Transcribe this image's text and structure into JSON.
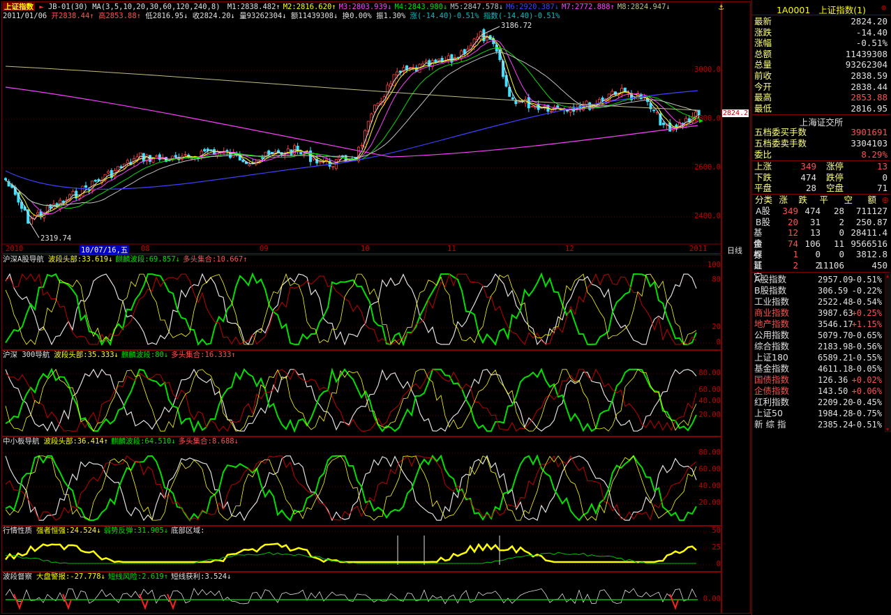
{
  "top": {
    "title": "上证指数",
    "formula": "JB-01(30)",
    "ma_label": "MA(3,5,10,20,30,60,120,240,8)",
    "ma_values": [
      {
        "text": "M1:2838.482↑",
        "color": "#e0e0e0"
      },
      {
        "text": "M2:2816.620↑",
        "color": "#ffff00"
      },
      {
        "text": "M3:2803.939↓",
        "color": "#ff40ff"
      },
      {
        "text": "M4:2843.980↓",
        "color": "#00e000"
      },
      {
        "text": "M5:2847.578↓",
        "color": "#c0c0c0"
      },
      {
        "text": "M6:2920.387↓",
        "color": "#4040ff"
      },
      {
        "text": "M7:2772.888↑",
        "color": "#ff40ff"
      },
      {
        "text": "M8:2824.947↓",
        "color": "#c0c080"
      }
    ],
    "info": {
      "date": "2011/01/06",
      "open": "开2838.44↑",
      "high": "高2853.88↑",
      "low": "低2816.95↓",
      "close": "收2824.20↓",
      "volume": "量93262304↓",
      "amount": "额11439308↓",
      "turnover": "换0.00%",
      "amplitude": "振1.30%",
      "change": "涨(-14.40)-0.51%",
      "index_change": "指数(-14.40)-0.51%"
    },
    "peak_label": "3186.72",
    "low_label": "2319.74",
    "current_price_tag": "2824.2",
    "y_ticks": [
      "3000.0",
      "2800.0",
      "2600.0",
      "2400.0"
    ],
    "x_ticks": [
      "2010",
      "08",
      "09",
      "10",
      "11",
      "12",
      "2011"
    ],
    "date_cursor": "10/07/16,五",
    "period": "日线"
  },
  "panels": [
    {
      "title": "沪深A股导航",
      "a": "波段头部:33.619↓",
      "b": "麒麟波段:69.857↓",
      "c": "多头集合:10.667↑",
      "ticks": [
        "100",
        "80",
        "20",
        "0"
      ]
    },
    {
      "title": "沪深 300导航",
      "a": "波段头部:35.333↓",
      "b": "麒麟波段:80↓",
      "c": "多头集合:16.333↑",
      "ticks": [
        "80.00",
        "60.00",
        "40.00",
        "20.00"
      ]
    },
    {
      "title": "中小板导航",
      "a": "波段头部:36.414↑",
      "b": "麒麟波段:64.510↓",
      "c": "多头集合:8.688↓",
      "ticks": [
        "80.00",
        "60.00",
        "40.00",
        "20.00"
      ]
    },
    {
      "title": "行情性质",
      "a": "强者恒强:24.524↓",
      "b": "弱势反弹:31.905↓",
      "c": "底部区域:",
      "ticks": [
        "50",
        "25",
        "0"
      ]
    },
    {
      "title": "波段督察",
      "a": "大盘警报:-27.778↓",
      "b": "短线风险:2.619↑",
      "c": "短线获利:3.524↓",
      "ticks": [
        "0.00"
      ]
    }
  ],
  "right": {
    "code": "1A0001",
    "name": "上证指数(1)",
    "quotes": [
      {
        "label": "最新",
        "value": "2824.20",
        "color": "#e0e0e0"
      },
      {
        "label": "涨跌",
        "value": "-14.40",
        "color": "#e0e0e0"
      },
      {
        "label": "涨幅",
        "value": "-0.51%",
        "color": "#e0e0e0"
      },
      {
        "label": "总额",
        "value": "11439308",
        "color": "#e0e0e0"
      },
      {
        "label": "总量",
        "value": "93262304",
        "color": "#e0e0e0"
      },
      {
        "label": "前收",
        "value": "2838.59",
        "color": "#e0e0e0"
      },
      {
        "label": "今开",
        "value": "2838.44",
        "color": "#e0e0e0"
      },
      {
        "label": "最高",
        "value": "2853.88",
        "color": "#ff5050"
      },
      {
        "label": "最低",
        "value": "2816.95",
        "color": "#e0e0e0"
      }
    ],
    "exchange": "上海证交所",
    "orders": [
      {
        "label": "五档委买手数",
        "value": "3901691",
        "color": "#ff5050"
      },
      {
        "label": "五档委卖手数",
        "value": "3304103",
        "color": "#e0e0e0"
      },
      {
        "label": "委比",
        "value": "8.29%",
        "color": "#ff5050"
      }
    ],
    "breadth": [
      {
        "l1": "上涨",
        "v1": "349",
        "c1": "#ff5050",
        "l2": "涨停",
        "v2": "13",
        "c2": "#ff5050"
      },
      {
        "l1": "下跌",
        "v1": "474",
        "c1": "#e0e0e0",
        "l2": "跌停",
        "v2": "0",
        "c2": "#e0e0e0"
      },
      {
        "l1": "平盘",
        "v1": "28",
        "c1": "#e0e0e0",
        "l2": "空盘",
        "v2": "71",
        "c2": "#e0e0e0"
      }
    ],
    "table_header": [
      "分类",
      "涨",
      "跌",
      "平",
      "空",
      "额"
    ],
    "table_rows": [
      {
        "cat": "A股",
        "up": "349",
        "down": "474",
        "flat": "28",
        "amt": "711127"
      },
      {
        "cat": "B股",
        "up": "20",
        "down": "31",
        "flat": "2",
        "amt": "250.87"
      },
      {
        "cat": "基金",
        "up": "12",
        "down": "13",
        "flat": "0",
        "amt": "28411.4"
      },
      {
        "cat": "债券",
        "up": "74",
        "down": "106",
        "flat": "11",
        "amt": "9566516"
      },
      {
        "cat": "权证",
        "up": "1",
        "down": "0",
        "flat": "0",
        "amt": "3812.8"
      },
      {
        "cat": "其它",
        "up": "2",
        "down": "2",
        "flat": "11106",
        "amt": "450"
      }
    ],
    "indices": [
      {
        "name": "A股指数",
        "value": "2957.09",
        "pct": "-0.51%",
        "color": "#e0e0e0"
      },
      {
        "name": "B股指数",
        "value": "306.59",
        "pct": "-0.22%",
        "color": "#e0e0e0"
      },
      {
        "name": "工业指数",
        "value": "2522.48",
        "pct": "-0.54%",
        "color": "#e0e0e0"
      },
      {
        "name": "商业指数",
        "value": "3987.63",
        "pct": "+0.25%",
        "color": "#ff5050"
      },
      {
        "name": "地产指数",
        "value": "3546.17",
        "pct": "+1.15%",
        "color": "#ff5050"
      },
      {
        "name": "公用指数",
        "value": "5079.70",
        "pct": "-0.65%",
        "color": "#e0e0e0"
      },
      {
        "name": "综合指数",
        "value": "2183.98",
        "pct": "-0.56%",
        "color": "#e0e0e0"
      },
      {
        "name": "上证180",
        "value": "6589.21",
        "pct": "-0.55%",
        "color": "#e0e0e0"
      },
      {
        "name": "基金指数",
        "value": "4611.18",
        "pct": "-0.05%",
        "color": "#e0e0e0"
      },
      {
        "name": "国债指数",
        "value": "126.36",
        "pct": "+0.02%",
        "color": "#ff5050"
      },
      {
        "name": "企债指数",
        "value": "143.50",
        "pct": "+0.06%",
        "color": "#ff5050"
      },
      {
        "name": "红利指数",
        "value": "2209.20",
        "pct": "-0.45%",
        "color": "#e0e0e0"
      },
      {
        "name": "上证50",
        "value": "1984.28",
        "pct": "-0.75%",
        "color": "#e0e0e0"
      },
      {
        "name": "新 综 指",
        "value": "2385.24",
        "pct": "-0.51%",
        "color": "#e0e0e0"
      }
    ]
  }
}
